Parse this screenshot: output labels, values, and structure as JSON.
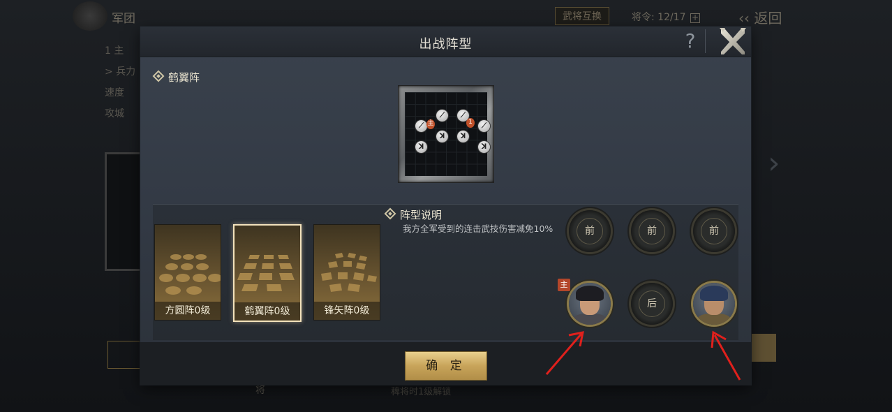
{
  "background": {
    "legion_label": "军团",
    "swap_button": "武将互换",
    "orders_label": "将令: 12/17",
    "back_button": "返回",
    "left_items": [
      "1 主",
      "> 兵力",
      "速度",
      "攻城"
    ],
    "bottom_hint": "稗将时1级解锁",
    "side_label": "将"
  },
  "modal": {
    "title": "出战阵型",
    "help_icon": "?",
    "formation_name": "鹤翼阵",
    "preview": {
      "lord_marker": "主",
      "number_marker": "1"
    },
    "formations": [
      {
        "label": "方圆阵0级",
        "selected": false
      },
      {
        "label": "鹤翼阵0级",
        "selected": true
      },
      {
        "label": "锋矢阵0级",
        "selected": false
      }
    ],
    "description": {
      "title": "阵型说明",
      "text": "我方全军受到的连击武技伤害减免10%"
    },
    "slots": {
      "front": [
        "前",
        "前",
        "前"
      ],
      "back_label": "后",
      "lord_badge": "主"
    },
    "confirm_button": "确 定"
  },
  "colors": {
    "accent_gold": "#c8a45a",
    "annotation_red": "#e0201c"
  }
}
